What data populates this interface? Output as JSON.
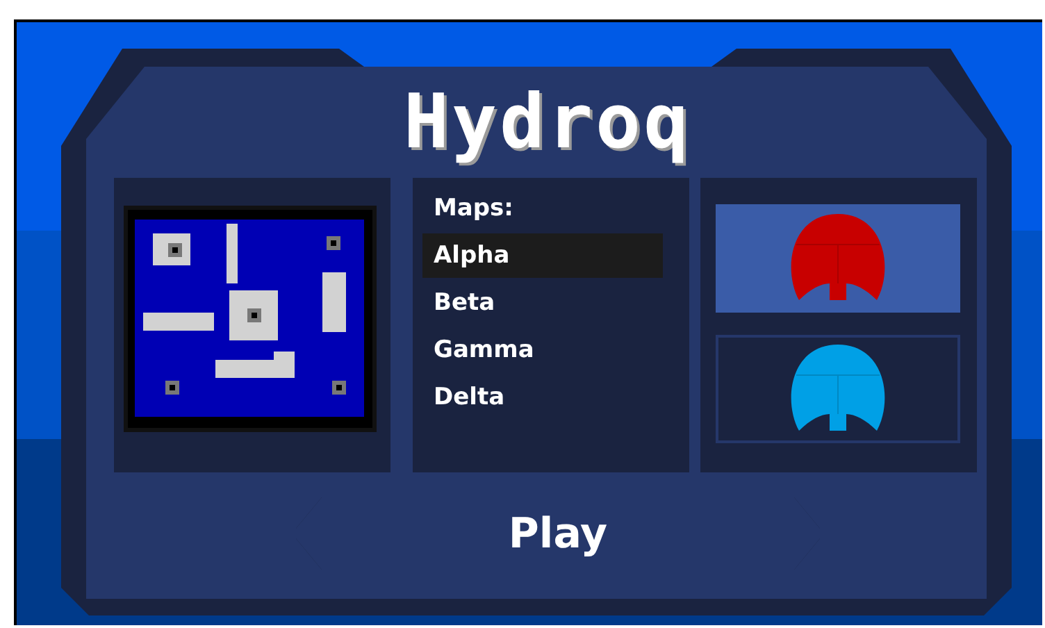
{
  "title": "Hydroq",
  "maps": {
    "heading": "Maps:",
    "items": [
      {
        "label": "Alpha",
        "selected": true
      },
      {
        "label": "Beta",
        "selected": false
      },
      {
        "label": "Gamma",
        "selected": false
      },
      {
        "label": "Delta",
        "selected": false
      }
    ]
  },
  "teams": [
    {
      "color": "#c80000",
      "selected": true
    },
    {
      "color": "#00a0e6",
      "selected": false
    }
  ],
  "play_button": "Play"
}
